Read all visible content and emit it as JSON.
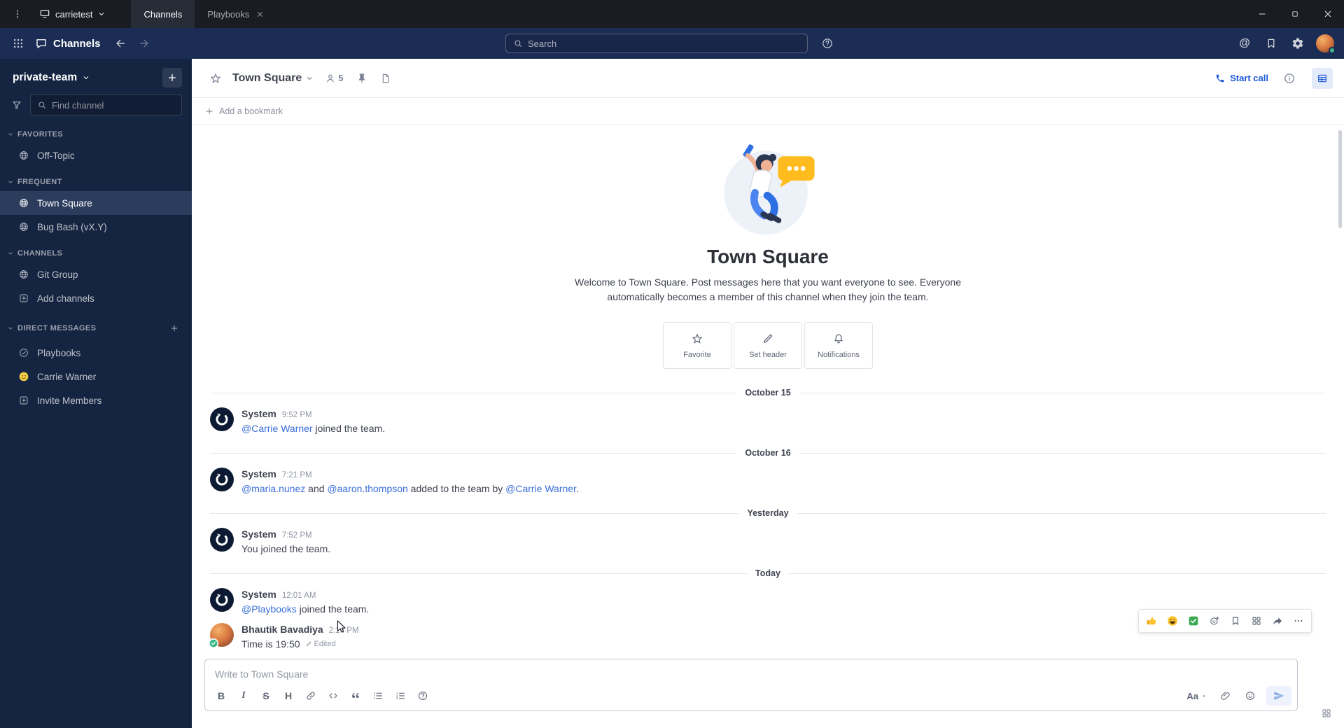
{
  "colors": {
    "accent_blue": "#1c58d9",
    "online_green": "#3db887",
    "mention_blue": "#3a6fd9",
    "bubble_yellow": "#ffbc1f"
  },
  "window": {
    "server_name": "carrietest",
    "tabs": [
      {
        "label": "Channels",
        "active": true,
        "closable": false
      },
      {
        "label": "Playbooks",
        "active": false,
        "closable": true
      }
    ]
  },
  "global_header": {
    "product_label": "Channels",
    "search_placeholder": "Search",
    "mentions_glyph": "@"
  },
  "sidebar": {
    "team_name": "private-team",
    "find_channel_placeholder": "Find channel",
    "sections": [
      {
        "label": "FAVORITES",
        "items": [
          {
            "label": "Off-Topic",
            "icon": "globe"
          }
        ]
      },
      {
        "label": "FREQUENT",
        "items": [
          {
            "label": "Town Square",
            "icon": "globe",
            "active": true
          },
          {
            "label": "Bug Bash (vX.Y)",
            "icon": "globe"
          }
        ]
      },
      {
        "label": "CHANNELS",
        "items": [
          {
            "label": "Git Group",
            "icon": "globe"
          },
          {
            "label": "Add channels",
            "icon": "plus-box"
          }
        ]
      },
      {
        "label": "DIRECT MESSAGES",
        "add_button": true,
        "items": [
          {
            "label": "Playbooks",
            "icon": "playbooks"
          },
          {
            "label": "Carrie Warner",
            "icon": "emoji-avatar"
          },
          {
            "label": "Invite Members",
            "icon": "plus-box"
          }
        ]
      }
    ]
  },
  "channel_header": {
    "title": "Town Square",
    "member_count": "5",
    "start_call_label": "Start call"
  },
  "bookmark_bar": {
    "label": "Add a bookmark"
  },
  "intro": {
    "title": "Town Square",
    "description": "Welcome to Town Square. Post messages here that you want everyone to see. Everyone automatically becomes a member of this channel when they join the team.",
    "actions": [
      {
        "label": "Favorite",
        "icon": "star"
      },
      {
        "label": "Set header",
        "icon": "pencil"
      },
      {
        "label": "Notifications",
        "icon": "bell"
      }
    ]
  },
  "messages": [
    {
      "type": "date",
      "label": "October 15"
    },
    {
      "type": "system",
      "avatar": "system",
      "author": "System",
      "time": "9:52 PM",
      "parts": [
        {
          "text": "@Carrie Warner",
          "link": true
        },
        {
          "text": " joined the team."
        }
      ]
    },
    {
      "type": "date",
      "label": "October 16"
    },
    {
      "type": "system",
      "avatar": "system",
      "author": "System",
      "time": "7:21 PM",
      "parts": [
        {
          "text": "@maria.nunez",
          "link": true
        },
        {
          "text": " and "
        },
        {
          "text": "@aaron.thompson",
          "link": true
        },
        {
          "text": " added to the team by "
        },
        {
          "text": "@Carrie Warner",
          "link": true
        },
        {
          "text": "."
        }
      ]
    },
    {
      "type": "date",
      "label": "Yesterday"
    },
    {
      "type": "system",
      "avatar": "system",
      "author": "System",
      "time": "7:52 PM",
      "parts": [
        {
          "text": "You joined the team."
        }
      ]
    },
    {
      "type": "date",
      "label": "Today"
    },
    {
      "type": "system",
      "avatar": "system",
      "author": "System",
      "time": "12:01 AM",
      "parts": [
        {
          "text": "@Playbooks",
          "link": true
        },
        {
          "text": " joined the team."
        }
      ]
    },
    {
      "type": "user",
      "avatar": "photo",
      "author": "Bhautik Bavadiya",
      "time": "2:14 PM",
      "parts": [
        {
          "text": "Time is 19:50"
        }
      ],
      "edited_label": "Edited",
      "show_actions": true
    }
  ],
  "message_actions": {
    "reactions": [
      {
        "name": "thumbs-up"
      },
      {
        "name": "grinning-smile"
      },
      {
        "name": "check-mark"
      }
    ],
    "buttons": [
      {
        "name": "add-reaction"
      },
      {
        "name": "save-message"
      },
      {
        "name": "message-apps"
      },
      {
        "name": "reply"
      },
      {
        "name": "more-actions"
      }
    ]
  },
  "composer": {
    "placeholder": "Write to Town Square",
    "format_label": "Aa",
    "toolbar": [
      {
        "name": "bold",
        "glyph": "B"
      },
      {
        "name": "italic",
        "glyph": "I"
      },
      {
        "name": "strikethrough",
        "glyph": "S"
      },
      {
        "name": "heading",
        "glyph": "H"
      },
      {
        "name": "link"
      },
      {
        "name": "code"
      },
      {
        "name": "quote"
      },
      {
        "name": "bulleted-list"
      },
      {
        "name": "numbered-list"
      },
      {
        "name": "formatting-help"
      }
    ]
  }
}
